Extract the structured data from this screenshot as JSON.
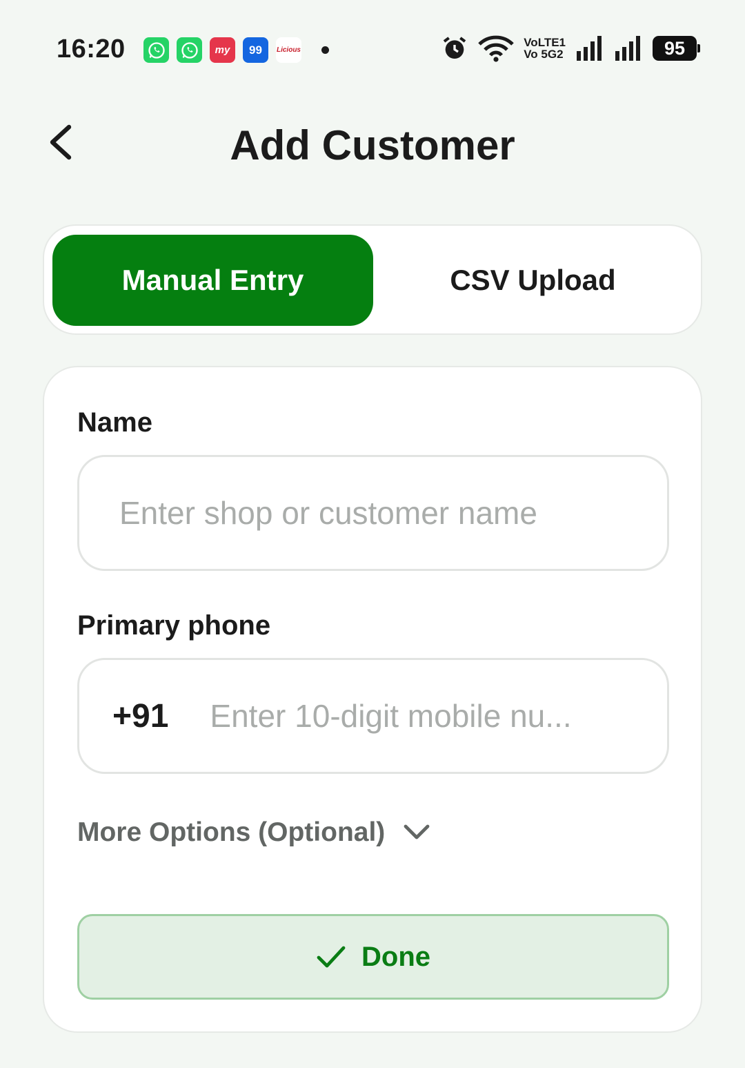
{
  "status_bar": {
    "time": "16:20",
    "notification_icons": [
      {
        "name": "whatsapp-icon",
        "color": "#25d366"
      },
      {
        "name": "whatsapp-business-icon",
        "color": "#25d366"
      },
      {
        "name": "bookmyshow-icon",
        "label": "my",
        "color": "#e5364b"
      },
      {
        "name": "99acres-icon",
        "label": "99",
        "color": "#1466e0"
      },
      {
        "name": "licious-icon",
        "label": "Licious",
        "color": "#ffffff"
      }
    ],
    "volte_top": "VoLTE1",
    "volte_bottom": "Vo 5G2",
    "battery": "95"
  },
  "header": {
    "title": "Add Customer"
  },
  "tabs": {
    "manual": "Manual Entry",
    "csv": "CSV Upload",
    "active": "manual",
    "active_color": "#057f10"
  },
  "form": {
    "name_label": "Name",
    "name_placeholder": "Enter shop or customer name",
    "phone_label": "Primary phone",
    "phone_prefix": "+91",
    "phone_placeholder": "Enter 10-digit mobile nu...",
    "more_options": "More Options (Optional)",
    "done_label": "Done"
  }
}
